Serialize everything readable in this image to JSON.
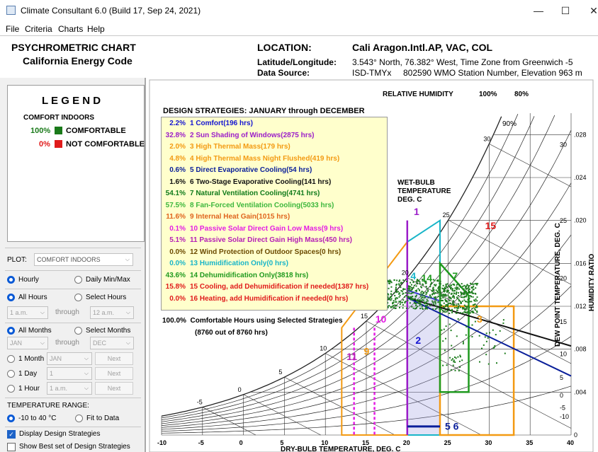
{
  "window": {
    "title": "Climate Consultant 6.0 (Build 17, Sep 24, 2021)",
    "minimize": "—",
    "maximize": "☐",
    "close": "✕"
  },
  "menu": [
    "File",
    "Criteria",
    "Charts",
    "Help"
  ],
  "header": {
    "chart_title": "PSYCHROMETRIC CHART",
    "code": "California Energy Code",
    "location_label": "LOCATION:",
    "location_value": "Cali Aragon.Intl.AP, VAC, COL",
    "latlon_label": "Latitude/Longitude:",
    "latlon_value": "3.543° North, 76.382° West, Time Zone from Greenwich -5",
    "source_label": "Data Source:",
    "source_value": "ISD-TMYx     802590 WMO Station Number, Elevation 963 m"
  },
  "legend": {
    "title": "L E G E N D",
    "subtitle": "COMFORT INDOORS",
    "items": [
      {
        "pct": "100%",
        "label": "COMFORTABLE",
        "color": "#1a7a1a"
      },
      {
        "pct": "0%",
        "label": "NOT COMFORTABLE",
        "color": "#e01b1b"
      }
    ]
  },
  "controls": {
    "plot_label": "PLOT:",
    "plot_value": "COMFORT INDOORS",
    "hourly": "Hourly",
    "daily": "Daily Min/Max",
    "all_hours": "All Hours",
    "select_hours": "Select Hours",
    "hour_from": "1 a.m.",
    "through": "through",
    "hour_to": "12 a.m.",
    "all_months": "All Months",
    "select_months": "Select Months",
    "month_from": "JAN",
    "month_to": "DEC",
    "one_month": "1 Month",
    "one_month_value": "JAN",
    "one_day": "1 Day",
    "one_day_value": "1",
    "one_hour": "1 Hour",
    "one_hour_value": "1 a.m.",
    "next": "Next",
    "temp_range_label": "TEMPERATURE RANGE:",
    "temp_range_value": "-10 to 40 °C",
    "fit_to_data": "Fit to Data",
    "display_strategies": "Display Design Strategies",
    "show_best": "Show Best set of Design Strategies"
  },
  "chart_data": {
    "type": "scatter",
    "title": "DESIGN STRATEGIES: JANUARY through DECEMBER",
    "xlabel": "DRY-BULB TEMPERATURE, DEG. C",
    "ylabel": "HUMIDITY RATIO",
    "x_ticks": [
      "-10",
      "-5",
      "0",
      "5",
      "10",
      "15",
      "20",
      "25",
      "30",
      "35",
      "40"
    ],
    "y_ticks": [
      ".028",
      ".024",
      ".020",
      ".016",
      ".012",
      ".008",
      ".004",
      "0"
    ],
    "rh_header": "RELATIVE HUMIDITY",
    "rh_labels": [
      "100%",
      "80%"
    ],
    "rh_90": "90%",
    "wet_bulb_label": "WET-BULB TEMPERATURE DEG. C",
    "dew_point_label": "DEW POINT TEMPERATURE, DEG. C",
    "wb_ticks": [
      "-5",
      "0",
      "5",
      "10",
      "15",
      "20",
      "25",
      "30"
    ],
    "dp_ticks": [
      "30",
      "25",
      "20",
      "15",
      "10",
      "5",
      "0",
      "-5",
      "-10"
    ],
    "summary_pct": "100.0%",
    "summary_text": "Comfortable Hours using Selected Strategies",
    "summary_sub": "(8760 out of 8760 hrs)",
    "strategies": [
      {
        "pct": "2.2%",
        "label": "1 Comfort(196 hrs)",
        "color": "#1414d2"
      },
      {
        "pct": "32.8%",
        "label": "2 Sun Shading of Windows(2875 hrs)",
        "color": "#9b1dc9"
      },
      {
        "pct": "2.0%",
        "label": "3 High Thermal Mass(179 hrs)",
        "color": "#f39a12"
      },
      {
        "pct": "4.8%",
        "label": "4 High Thermal Mass Night Flushed(419 hrs)",
        "color": "#f39a12"
      },
      {
        "pct": "0.6%",
        "label": "5 Direct Evaporative Cooling(54 hrs)",
        "color": "#0a1f9a"
      },
      {
        "pct": "1.6%",
        "label": "6 Two-Stage Evaporative Cooling(141 hrs)",
        "color": "#111111"
      },
      {
        "pct": "54.1%",
        "label": "7 Natural Ventilation Cooling(4741 hrs)",
        "color": "#0f7a1a"
      },
      {
        "pct": "57.5%",
        "label": "8 Fan-Forced Ventilation Cooling(5033 hrs)",
        "color": "#3db73d"
      },
      {
        "pct": "11.6%",
        "label": "9 Internal Heat Gain(1015 hrs)",
        "color": "#e0641e"
      },
      {
        "pct": "0.1%",
        "label": "10 Passive Solar Direct Gain Low Mass(9 hrs)",
        "color": "#e41ce4"
      },
      {
        "pct": "5.1%",
        "label": "11 Passive Solar Direct Gain High Mass(450 hrs)",
        "color": "#b51fb5"
      },
      {
        "pct": "0.0%",
        "label": "12 Wind Protection of Outdoor Spaces(0 hrs)",
        "color": "#6b4a00"
      },
      {
        "pct": "0.0%",
        "label": "13 Humidification Only(0 hrs)",
        "color": "#18b5c8"
      },
      {
        "pct": "43.6%",
        "label": "14 Dehumidification Only(3818 hrs)",
        "color": "#1f9a1f"
      },
      {
        "pct": "15.8%",
        "label": "15 Cooling, add Dehumidification if needed(1387 hrs)",
        "color": "#e01b1b"
      },
      {
        "pct": "0.0%",
        "label": "16 Heating, add Humidification if needed(0 hrs)",
        "color": "#e01b1b"
      }
    ],
    "zone_numbers": [
      "1",
      "2",
      "3",
      "4",
      "5 6",
      "7",
      "9",
      "10",
      "11",
      "14",
      "15"
    ],
    "xlim": [
      -10,
      40
    ],
    "ylim": [
      0,
      0.03
    ]
  }
}
